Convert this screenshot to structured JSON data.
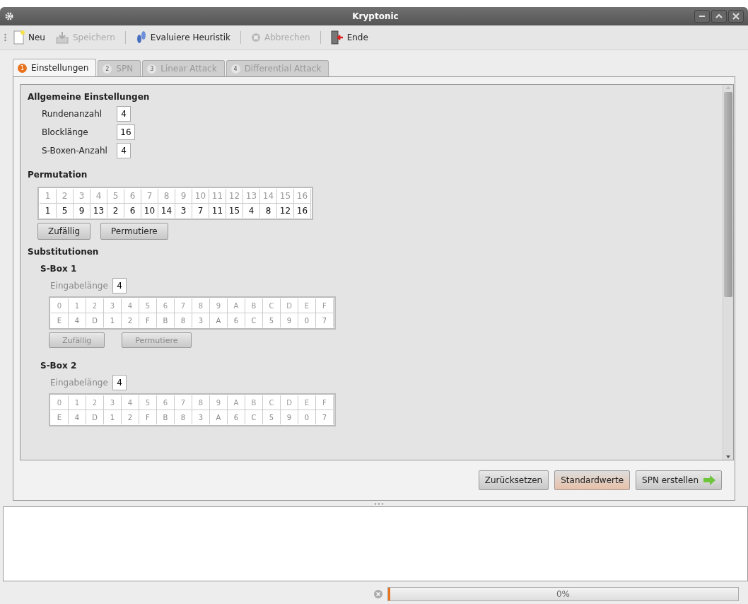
{
  "window": {
    "title": "Kryptonic"
  },
  "toolbar": [
    {
      "label": "Neu",
      "kind": "new",
      "disabled": false
    },
    {
      "label": "Speichern",
      "kind": "save",
      "disabled": true
    },
    {
      "label": "Evaluiere Heuristik",
      "kind": "evaluate",
      "disabled": false
    },
    {
      "label": "Abbrechen",
      "kind": "cancel",
      "disabled": true
    },
    {
      "label": "Ende",
      "kind": "exit",
      "disabled": false
    }
  ],
  "tabs": [
    {
      "number": "1",
      "label": "Einstellungen",
      "selected": true,
      "disabled": false
    },
    {
      "number": "2",
      "label": "SPN",
      "selected": false,
      "disabled": true
    },
    {
      "number": "3",
      "label": "Linear Attack",
      "selected": false,
      "disabled": true
    },
    {
      "number": "4",
      "label": "Differential Attack",
      "selected": false,
      "disabled": true
    }
  ],
  "general": {
    "title": "Allgemeine Einstellungen",
    "fields": [
      {
        "label": "Rundenanzahl",
        "value": "4"
      },
      {
        "label": "Blocklänge",
        "value": "16"
      },
      {
        "label": "S-Boxen-Anzahl",
        "value": "4"
      }
    ]
  },
  "permutation": {
    "title": "Permutation",
    "disabled": false,
    "inputs": [
      "1",
      "2",
      "3",
      "4",
      "5",
      "6",
      "7",
      "8",
      "9",
      "10",
      "11",
      "12",
      "13",
      "14",
      "15",
      "16"
    ],
    "outputs": [
      "1",
      "5",
      "9",
      "13",
      "2",
      "6",
      "10",
      "14",
      "3",
      "7",
      "11",
      "15",
      "4",
      "8",
      "12",
      "16"
    ],
    "buttons": [
      "Zufällig",
      "Permutiere"
    ]
  },
  "substitutions": {
    "title": "Substitutionen",
    "sboxes": [
      {
        "title": "S-Box 1",
        "input_label": "Eingabelänge",
        "input_value": "4",
        "disabled": true,
        "inputs": [
          "0",
          "1",
          "2",
          "3",
          "4",
          "5",
          "6",
          "7",
          "8",
          "9",
          "A",
          "B",
          "C",
          "D",
          "E",
          "F"
        ],
        "outputs": [
          "E",
          "4",
          "D",
          "1",
          "2",
          "F",
          "B",
          "8",
          "3",
          "A",
          "6",
          "C",
          "5",
          "9",
          "0",
          "7"
        ],
        "buttons": [
          "Zufällig",
          "Permutiere"
        ]
      },
      {
        "title": "S-Box 2",
        "input_label": "Eingabelänge",
        "input_value": "4",
        "disabled": true,
        "inputs": [
          "0",
          "1",
          "2",
          "3",
          "4",
          "5",
          "6",
          "7",
          "8",
          "9",
          "A",
          "B",
          "C",
          "D",
          "E",
          "F"
        ],
        "outputs": [
          "E",
          "4",
          "D",
          "1",
          "2",
          "F",
          "B",
          "8",
          "3",
          "A",
          "6",
          "C",
          "5",
          "9",
          "0",
          "7"
        ]
      }
    ]
  },
  "actions": [
    {
      "label": "Zurücksetzen",
      "kind": "plain",
      "focused": false
    },
    {
      "label": "Standardwerte",
      "kind": "plain",
      "focused": true
    },
    {
      "label": "SPN erstellen",
      "kind": "next",
      "focused": false
    }
  ],
  "status_bar": {
    "progress": {
      "level": 0,
      "reading": "0%"
    }
  }
}
